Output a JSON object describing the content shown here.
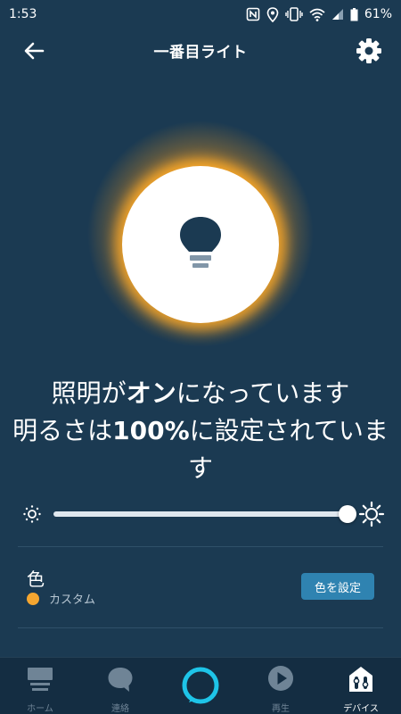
{
  "status_bar": {
    "time": "1:53",
    "battery": "61%",
    "icons": [
      "nfc-icon",
      "location-icon",
      "vibrate-icon",
      "wifi-icon",
      "signal-icon",
      "battery-icon"
    ]
  },
  "header": {
    "title": "一番目ライト",
    "back_icon": "arrow-left-icon",
    "settings_icon": "gear-icon"
  },
  "light": {
    "state": "on",
    "icon": "light-bulb-icon",
    "glow_color": "#ffaa22"
  },
  "status_text": {
    "part1": "照明が",
    "on": "オン",
    "part2": "になっています",
    "part3": "明るさは",
    "brightness": "100%",
    "part4": "に設定されています"
  },
  "brightness": {
    "value": 100,
    "min_icon": "sun-dim-icon",
    "max_icon": "sun-bright-icon"
  },
  "color": {
    "label": "色",
    "value": "カスタム",
    "swatch": "#f5a630",
    "button_label": "色を設定"
  },
  "nav": {
    "items": [
      {
        "label": "ホーム",
        "icon": "home-icon",
        "active": false
      },
      {
        "label": "連絡",
        "icon": "chat-bubble-icon",
        "active": false
      },
      {
        "label": "",
        "icon": "alexa-ring-icon",
        "active": false
      },
      {
        "label": "再生",
        "icon": "play-icon",
        "active": false
      },
      {
        "label": "デバイス",
        "icon": "devices-icon",
        "active": true
      }
    ]
  },
  "colors": {
    "background": "#1b3a52",
    "accent": "#2f83b1",
    "alexa": "#1ec4e8"
  }
}
